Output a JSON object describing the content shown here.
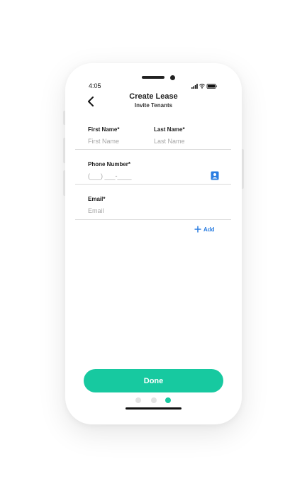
{
  "status_bar": {
    "time": "4:05"
  },
  "header": {
    "title": "Create Lease",
    "subtitle": "Invite Tenants",
    "back_icon": "chevron-left-icon"
  },
  "form": {
    "first_name": {
      "label": "First Name*",
      "placeholder": "First Name"
    },
    "last_name": {
      "label": "Last Name*",
      "placeholder": "Last Name"
    },
    "phone": {
      "label": "Phone Number*",
      "placeholder": "(___) ___-____",
      "icon": "contacts-icon"
    },
    "email": {
      "label": "Email*",
      "placeholder": "Email"
    },
    "add_label": "Add"
  },
  "footer": {
    "done_label": "Done",
    "pagination": {
      "count": 3,
      "active_index": 2
    }
  },
  "colors": {
    "accent": "#17c9a0",
    "link": "#2a7de1",
    "placeholder": "#a6a6a6",
    "divider": "#dadada"
  }
}
